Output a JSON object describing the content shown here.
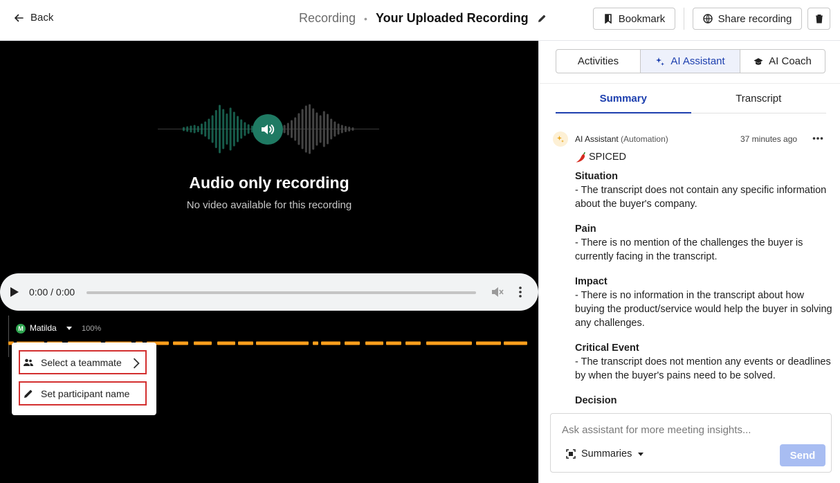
{
  "header": {
    "back_label": "Back",
    "breadcrumb": "Recording",
    "separator": "•",
    "title": "Your Uploaded Recording",
    "bookmark_label": "Bookmark",
    "share_label": "Share recording"
  },
  "stage": {
    "audio_title": "Audio only recording",
    "audio_subtitle": "No video available for this recording",
    "player_time": "0:00 / 0:00",
    "speaker_initial": "M",
    "speaker_name": "Matilda",
    "speaker_percent": "100%",
    "accent_color": "#ff9f1c",
    "wave_color": "#1f7a63"
  },
  "menu": {
    "items": [
      {
        "label": "Select a teammate"
      },
      {
        "label": "Set participant name"
      }
    ]
  },
  "panel": {
    "segments": [
      {
        "label": "Activities"
      },
      {
        "label": "AI Assistant"
      },
      {
        "label": "AI Coach"
      }
    ],
    "tabs": [
      {
        "label": "Summary"
      },
      {
        "label": "Transcript"
      }
    ],
    "message": {
      "author": "AI Assistant",
      "role": "(Automation)",
      "time": "37 minutes ago",
      "heading": "SPICED",
      "sections": [
        {
          "title": "Situation",
          "body": "- The transcript does not contain any specific information about the buyer's company."
        },
        {
          "title": "Pain",
          "body": "- There is no mention of the challenges the buyer is currently facing in the transcript."
        },
        {
          "title": "Impact",
          "body": "- There is no information in the transcript about how buying the product/service would help the buyer in solving any challenges."
        },
        {
          "title": "Critical Event",
          "body": "- The transcript does not mention any events or deadlines by when the buyer's pains need to be solved."
        },
        {
          "title": "Decision",
          "body": ""
        }
      ]
    },
    "composer": {
      "placeholder": "Ask assistant for more meeting insights...",
      "summaries_label": "Summaries",
      "send_label": "Send"
    }
  }
}
